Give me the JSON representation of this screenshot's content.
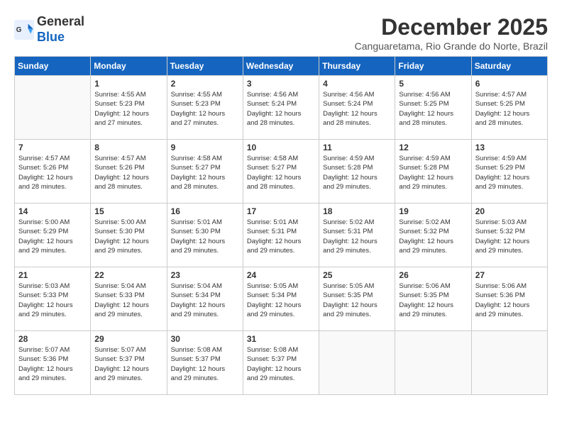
{
  "header": {
    "logo_general": "General",
    "logo_blue": "Blue",
    "month_title": "December 2025",
    "subtitle": "Canguaretama, Rio Grande do Norte, Brazil"
  },
  "days_of_week": [
    "Sunday",
    "Monday",
    "Tuesday",
    "Wednesday",
    "Thursday",
    "Friday",
    "Saturday"
  ],
  "weeks": [
    [
      {
        "day": "",
        "info": ""
      },
      {
        "day": "1",
        "info": "Sunrise: 4:55 AM\nSunset: 5:23 PM\nDaylight: 12 hours\nand 27 minutes."
      },
      {
        "day": "2",
        "info": "Sunrise: 4:55 AM\nSunset: 5:23 PM\nDaylight: 12 hours\nand 27 minutes."
      },
      {
        "day": "3",
        "info": "Sunrise: 4:56 AM\nSunset: 5:24 PM\nDaylight: 12 hours\nand 28 minutes."
      },
      {
        "day": "4",
        "info": "Sunrise: 4:56 AM\nSunset: 5:24 PM\nDaylight: 12 hours\nand 28 minutes."
      },
      {
        "day": "5",
        "info": "Sunrise: 4:56 AM\nSunset: 5:25 PM\nDaylight: 12 hours\nand 28 minutes."
      },
      {
        "day": "6",
        "info": "Sunrise: 4:57 AM\nSunset: 5:25 PM\nDaylight: 12 hours\nand 28 minutes."
      }
    ],
    [
      {
        "day": "7",
        "info": "Sunrise: 4:57 AM\nSunset: 5:26 PM\nDaylight: 12 hours\nand 28 minutes."
      },
      {
        "day": "8",
        "info": "Sunrise: 4:57 AM\nSunset: 5:26 PM\nDaylight: 12 hours\nand 28 minutes."
      },
      {
        "day": "9",
        "info": "Sunrise: 4:58 AM\nSunset: 5:27 PM\nDaylight: 12 hours\nand 28 minutes."
      },
      {
        "day": "10",
        "info": "Sunrise: 4:58 AM\nSunset: 5:27 PM\nDaylight: 12 hours\nand 28 minutes."
      },
      {
        "day": "11",
        "info": "Sunrise: 4:59 AM\nSunset: 5:28 PM\nDaylight: 12 hours\nand 29 minutes."
      },
      {
        "day": "12",
        "info": "Sunrise: 4:59 AM\nSunset: 5:28 PM\nDaylight: 12 hours\nand 29 minutes."
      },
      {
        "day": "13",
        "info": "Sunrise: 4:59 AM\nSunset: 5:29 PM\nDaylight: 12 hours\nand 29 minutes."
      }
    ],
    [
      {
        "day": "14",
        "info": "Sunrise: 5:00 AM\nSunset: 5:29 PM\nDaylight: 12 hours\nand 29 minutes."
      },
      {
        "day": "15",
        "info": "Sunrise: 5:00 AM\nSunset: 5:30 PM\nDaylight: 12 hours\nand 29 minutes."
      },
      {
        "day": "16",
        "info": "Sunrise: 5:01 AM\nSunset: 5:30 PM\nDaylight: 12 hours\nand 29 minutes."
      },
      {
        "day": "17",
        "info": "Sunrise: 5:01 AM\nSunset: 5:31 PM\nDaylight: 12 hours\nand 29 minutes."
      },
      {
        "day": "18",
        "info": "Sunrise: 5:02 AM\nSunset: 5:31 PM\nDaylight: 12 hours\nand 29 minutes."
      },
      {
        "day": "19",
        "info": "Sunrise: 5:02 AM\nSunset: 5:32 PM\nDaylight: 12 hours\nand 29 minutes."
      },
      {
        "day": "20",
        "info": "Sunrise: 5:03 AM\nSunset: 5:32 PM\nDaylight: 12 hours\nand 29 minutes."
      }
    ],
    [
      {
        "day": "21",
        "info": "Sunrise: 5:03 AM\nSunset: 5:33 PM\nDaylight: 12 hours\nand 29 minutes."
      },
      {
        "day": "22",
        "info": "Sunrise: 5:04 AM\nSunset: 5:33 PM\nDaylight: 12 hours\nand 29 minutes."
      },
      {
        "day": "23",
        "info": "Sunrise: 5:04 AM\nSunset: 5:34 PM\nDaylight: 12 hours\nand 29 minutes."
      },
      {
        "day": "24",
        "info": "Sunrise: 5:05 AM\nSunset: 5:34 PM\nDaylight: 12 hours\nand 29 minutes."
      },
      {
        "day": "25",
        "info": "Sunrise: 5:05 AM\nSunset: 5:35 PM\nDaylight: 12 hours\nand 29 minutes."
      },
      {
        "day": "26",
        "info": "Sunrise: 5:06 AM\nSunset: 5:35 PM\nDaylight: 12 hours\nand 29 minutes."
      },
      {
        "day": "27",
        "info": "Sunrise: 5:06 AM\nSunset: 5:36 PM\nDaylight: 12 hours\nand 29 minutes."
      }
    ],
    [
      {
        "day": "28",
        "info": "Sunrise: 5:07 AM\nSunset: 5:36 PM\nDaylight: 12 hours\nand 29 minutes."
      },
      {
        "day": "29",
        "info": "Sunrise: 5:07 AM\nSunset: 5:37 PM\nDaylight: 12 hours\nand 29 minutes."
      },
      {
        "day": "30",
        "info": "Sunrise: 5:08 AM\nSunset: 5:37 PM\nDaylight: 12 hours\nand 29 minutes."
      },
      {
        "day": "31",
        "info": "Sunrise: 5:08 AM\nSunset: 5:37 PM\nDaylight: 12 hours\nand 29 minutes."
      },
      {
        "day": "",
        "info": ""
      },
      {
        "day": "",
        "info": ""
      },
      {
        "day": "",
        "info": ""
      }
    ]
  ]
}
